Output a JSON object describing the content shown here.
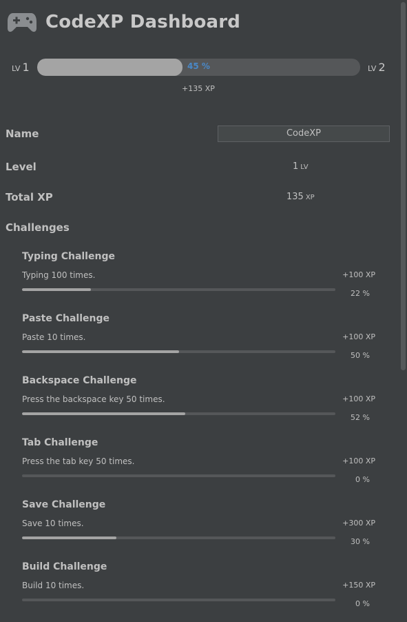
{
  "header": {
    "icon": "gamepad-icon",
    "title": "CodeXP Dashboard"
  },
  "level_bar": {
    "current_prefix": "LV",
    "current_level": "1",
    "next_prefix": "LV",
    "next_level": "2",
    "progress_percent": 45,
    "progress_label": "45 %",
    "xp_gain": "+135 XP",
    "accent_color": "#4a88c7"
  },
  "info": {
    "name_label": "Name",
    "name_value": "CodeXP",
    "level_label": "Level",
    "level_value": "1",
    "level_unit": "LV",
    "total_xp_label": "Total XP",
    "total_xp_value": "135",
    "total_xp_unit": "XP",
    "challenges_label": "Challenges"
  },
  "challenges": [
    {
      "title": "Typing Challenge",
      "desc": "Typing 100 times.",
      "reward": "+100 XP",
      "percent": 22,
      "percent_label": "22 %"
    },
    {
      "title": "Paste Challenge",
      "desc": "Paste 10 times.",
      "reward": "+100 XP",
      "percent": 50,
      "percent_label": "50 %"
    },
    {
      "title": "Backspace Challenge",
      "desc": "Press the backspace key 50 times.",
      "reward": "+100 XP",
      "percent": 52,
      "percent_label": "52 %"
    },
    {
      "title": "Tab Challenge",
      "desc": "Press the tab key 50 times.",
      "reward": "+100 XP",
      "percent": 0,
      "percent_label": "0 %"
    },
    {
      "title": "Save Challenge",
      "desc": "Save 10 times.",
      "reward": "+300 XP",
      "percent": 30,
      "percent_label": "30 %"
    },
    {
      "title": "Build Challenge",
      "desc": "Build 10 times.",
      "reward": "+150 XP",
      "percent": 0,
      "percent_label": "0 %"
    }
  ]
}
